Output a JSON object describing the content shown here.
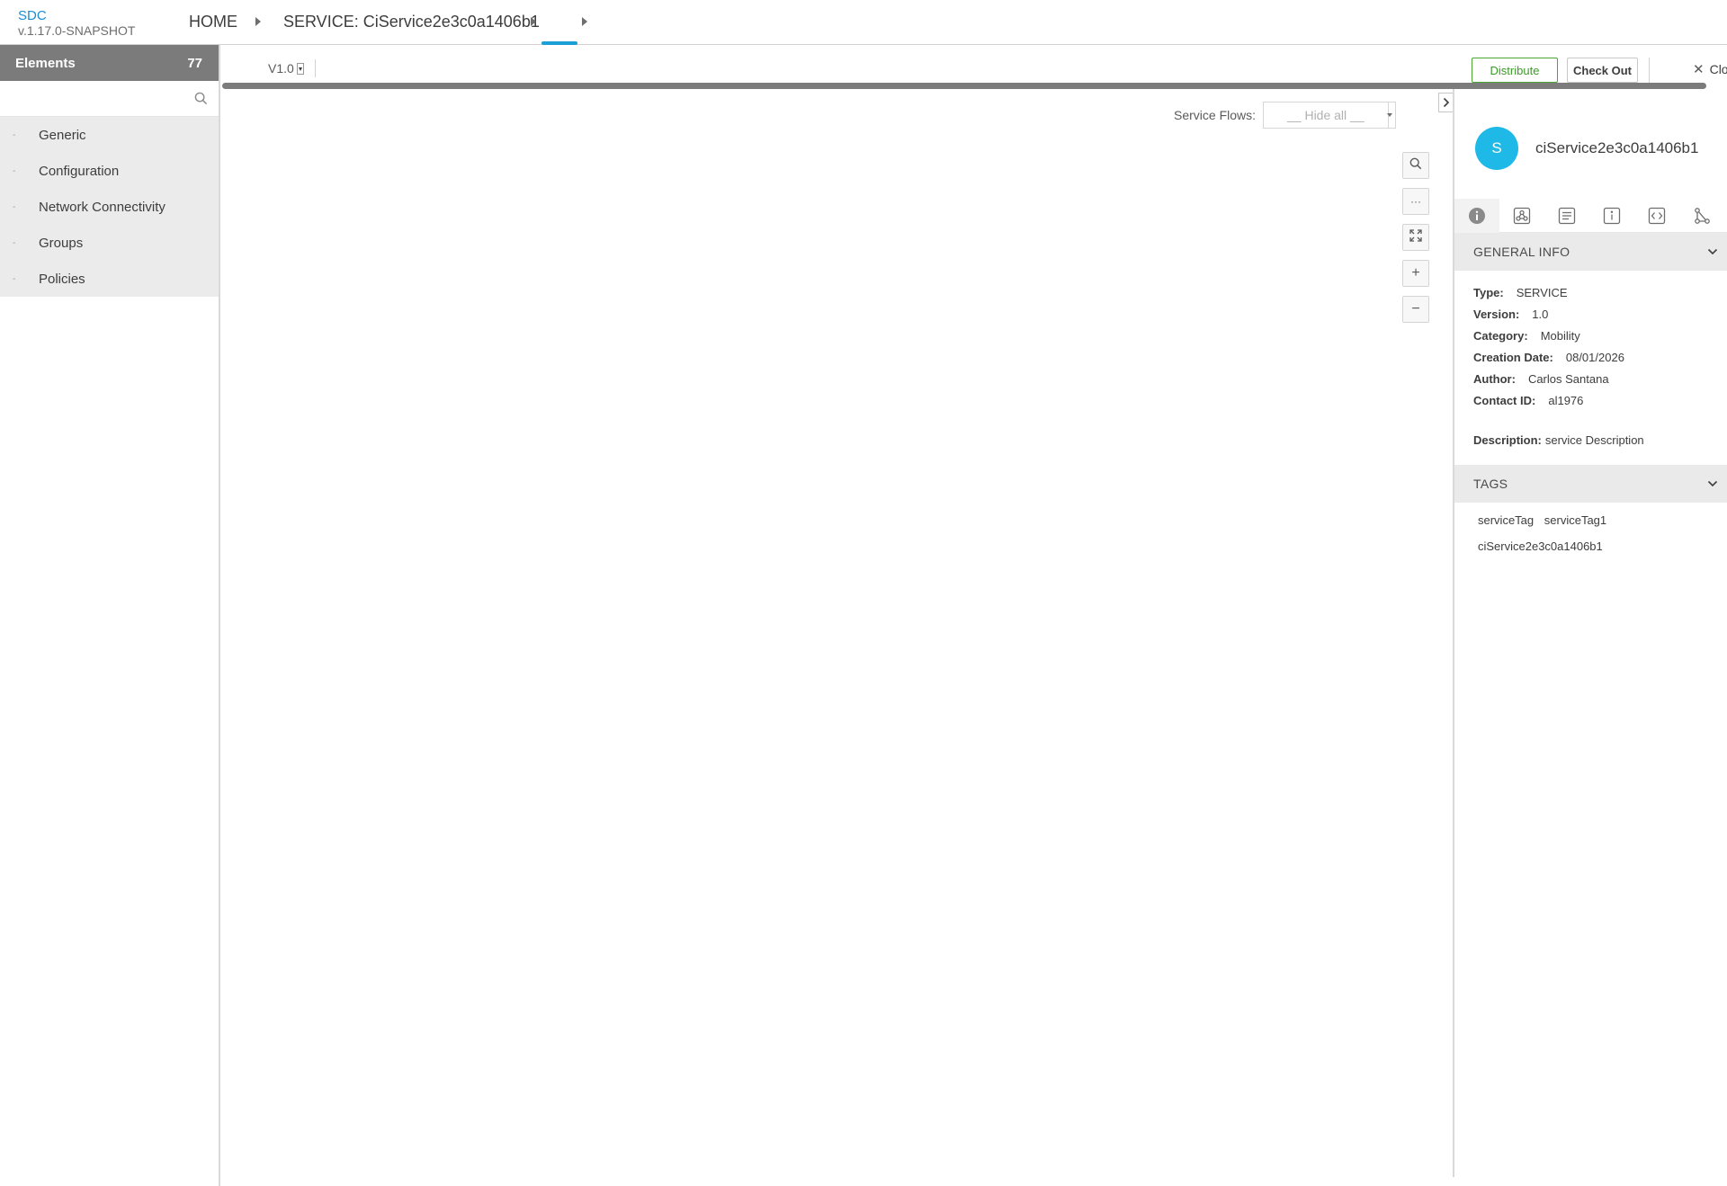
{
  "header": {
    "app_name": "SDC",
    "version": "v.1.17.0-SNAPSHOT",
    "breadcrumbs": [
      {
        "label": "HOME"
      },
      {
        "label": "SERVICE: CiService2e3c0a1406b1"
      },
      {
        "label": ""
      }
    ]
  },
  "sidebar": {
    "title": "Elements",
    "count": "77",
    "search_placeholder": "",
    "groups": [
      {
        "label": "Generic"
      },
      {
        "label": "Configuration"
      },
      {
        "label": "Network Connectivity"
      },
      {
        "label": "Groups"
      },
      {
        "label": "Policies"
      }
    ]
  },
  "toolbar": {
    "version_value": "V1.0",
    "distribute_label": "Distribute",
    "checkout_label": "Check Out",
    "close_label": "Clo"
  },
  "canvas": {
    "service_flows_label": "Service Flows:",
    "service_flows_value": "__ Hide all __",
    "tools": [
      {
        "name": "search-icon",
        "glyph": ""
      },
      {
        "name": "more-icon",
        "glyph": "···"
      },
      {
        "name": "fit-screen-icon",
        "glyph": ""
      },
      {
        "name": "zoom-in-icon",
        "glyph": "+"
      },
      {
        "name": "zoom-out-icon",
        "glyph": "−"
      }
    ]
  },
  "details": {
    "avatar_letter": "S",
    "title": "ciService2e3c0a1406b1",
    "tabs": [
      "info-icon",
      "composition-icon",
      "list-icon",
      "properties-icon",
      "api-icon",
      "graph-icon"
    ],
    "general_info_title": "GENERAL INFO",
    "info": [
      {
        "key": "Type:",
        "value": "SERVICE"
      },
      {
        "key": "Version:",
        "value": "1.0"
      },
      {
        "key": "Category:",
        "value": "Mobility"
      },
      {
        "key": "Creation Date:",
        "value": "08/01/2026"
      },
      {
        "key": "Author:",
        "value": "Carlos Santana"
      },
      {
        "key": "Contact ID:",
        "value": "al1976"
      }
    ],
    "description_key": "Description:",
    "description_value": "service Description",
    "tags_title": "TAGS",
    "tags": [
      "serviceTag",
      "serviceTag1",
      "ciService2e3c0a1406b1"
    ]
  },
  "colors": {
    "accent": "#1a9fd8",
    "avatar": "#1eb9e6",
    "distribute": "#3c9b29",
    "sidebar_header": "#7b7b7b"
  }
}
